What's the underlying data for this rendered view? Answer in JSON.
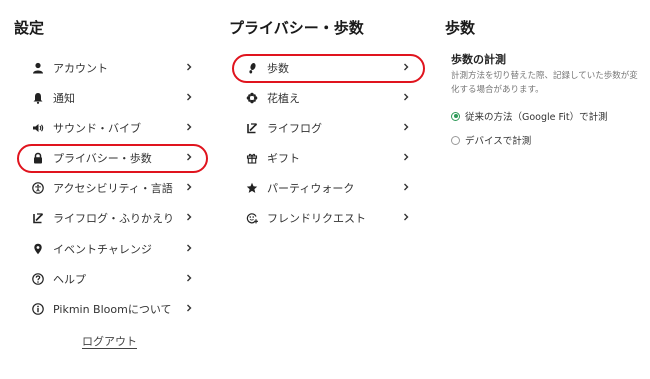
{
  "settings": {
    "title": "設定",
    "items": [
      {
        "label": "アカウント",
        "icon": "person-icon"
      },
      {
        "label": "通知",
        "icon": "bell-icon"
      },
      {
        "label": "サウンド・バイブ",
        "icon": "speaker-icon"
      },
      {
        "label": "プライバシー・歩数",
        "icon": "lock-icon"
      },
      {
        "label": "アクセシビリティ・言語",
        "icon": "accessibility-icon"
      },
      {
        "label": "ライフログ・ふりかえり",
        "icon": "lifelog-icon"
      },
      {
        "label": "イベントチャレンジ",
        "icon": "pin-icon"
      },
      {
        "label": "ヘルプ",
        "icon": "help-icon"
      },
      {
        "label": "Pikmin Bloomについて",
        "icon": "info-icon"
      }
    ],
    "logout_label": "ログアウト",
    "highlighted_item": "プライバシー・歩数"
  },
  "privacy": {
    "title": "プライバシー・歩数",
    "items": [
      {
        "label": "歩数",
        "icon": "footprint-icon"
      },
      {
        "label": "花植え",
        "icon": "flower-icon"
      },
      {
        "label": "ライフログ",
        "icon": "lifelog-icon"
      },
      {
        "label": "ギフト",
        "icon": "gift-icon"
      },
      {
        "label": "パーティウォーク",
        "icon": "star-icon"
      },
      {
        "label": "フレンドリクエスト",
        "icon": "friend-add-icon"
      }
    ],
    "highlighted_item": "歩数"
  },
  "steps": {
    "title": "歩数",
    "section_title": "歩数の計測",
    "description": "計測方法を切り替えた際、記録していた歩数が変化する場合があります。",
    "options": [
      {
        "label": "従来の方法（Google Fit）で計測",
        "selected": true
      },
      {
        "label": "デバイスで計測",
        "selected": false
      }
    ],
    "accent_color": "#2e9a58",
    "highlight_color": "#e0141e"
  }
}
